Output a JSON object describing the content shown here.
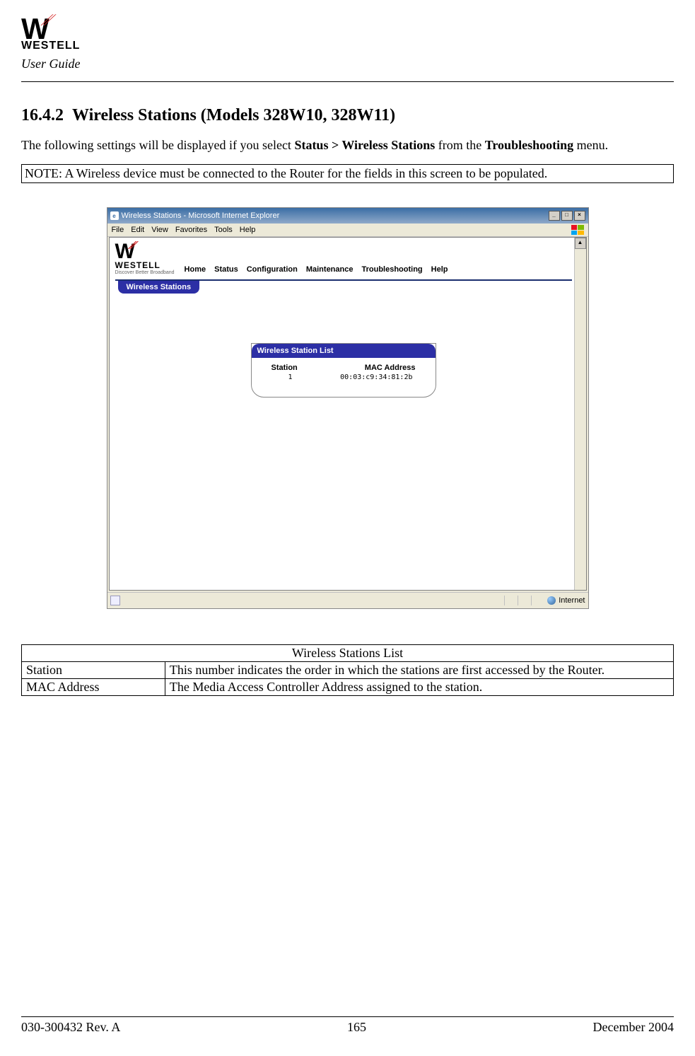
{
  "header": {
    "brand": "WESTELL",
    "user_guide": "User Guide"
  },
  "section": {
    "number": "16.4.2",
    "title": "Wireless Stations (Models 328W10, 328W11)"
  },
  "intro": {
    "prefix": "The following settings will be displayed if you select ",
    "bold1": "Status > Wireless Stations",
    "middle": " from the ",
    "bold2": "Troubleshooting",
    "suffix": " menu."
  },
  "note": "NOTE: A Wireless device must be connected to the Router for the fields in this screen to be populated.",
  "screenshot": {
    "title": "Wireless Stations - Microsoft Internet Explorer",
    "menubar": [
      "File",
      "Edit",
      "View",
      "Favorites",
      "Tools",
      "Help"
    ],
    "router_brand": "WESTELL",
    "router_tagline": "Discover Better Broadband",
    "nav": [
      "Home",
      "Status",
      "Configuration",
      "Maintenance",
      "Troubleshooting",
      "Help"
    ],
    "active_tab": "Wireless Stations",
    "card_title": "Wireless Station List",
    "col_station": "Station",
    "col_mac": "MAC Address",
    "rows": [
      {
        "station": "1",
        "mac": "00:03:c9:34:81:2b"
      }
    ],
    "status_zone": "Internet"
  },
  "table": {
    "title": "Wireless Stations List",
    "rows": [
      {
        "label": "Station",
        "desc": "This number indicates the order in which the stations are first accessed by the Router."
      },
      {
        "label": "MAC Address",
        "desc": "The Media Access Controller Address assigned to the station."
      }
    ]
  },
  "footer": {
    "left": "030-300432 Rev. A",
    "center": "165",
    "right": "December 2004"
  }
}
